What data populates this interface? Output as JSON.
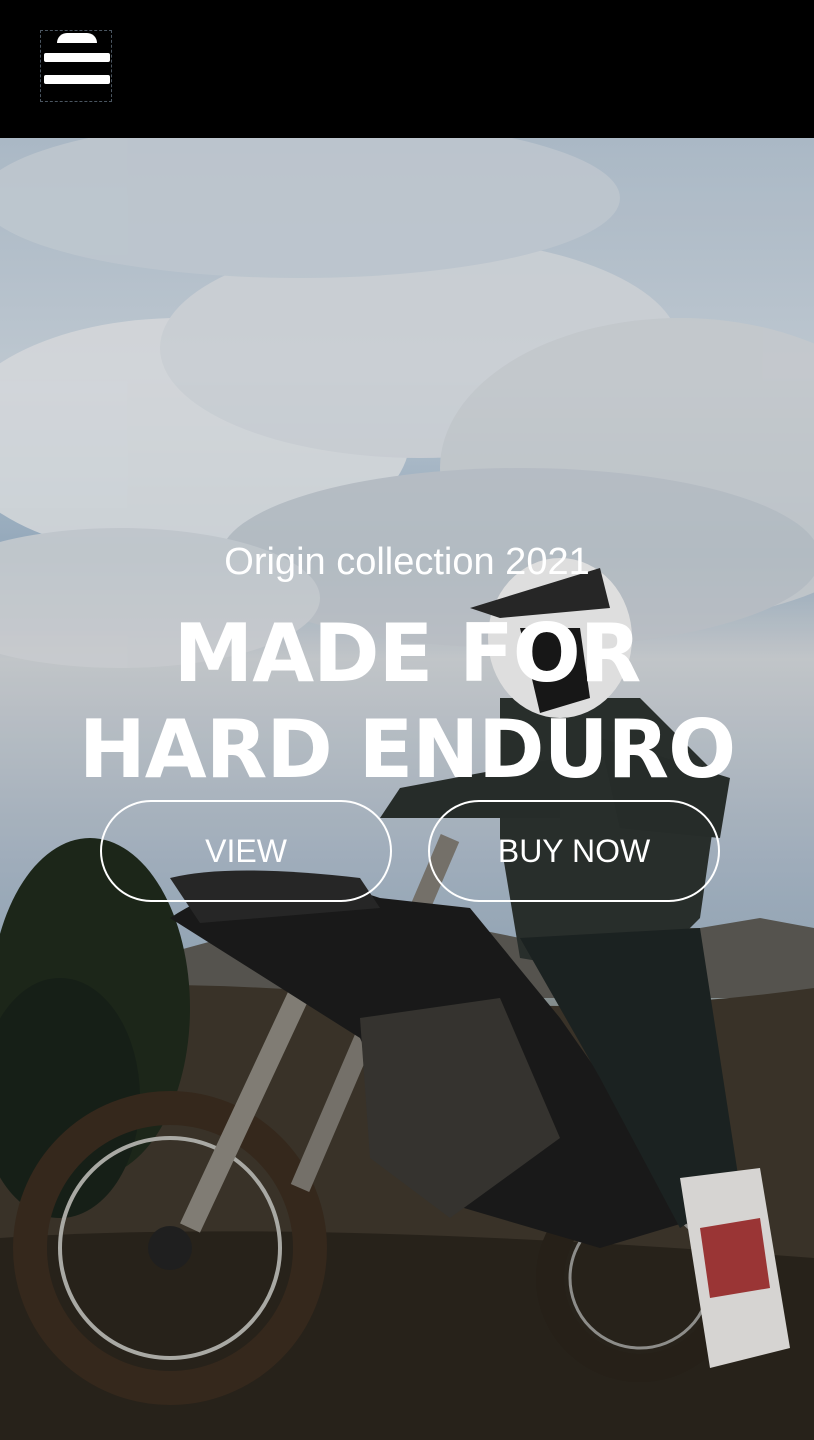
{
  "header": {
    "menu_button_label": "Menu"
  },
  "hero": {
    "subtitle": "Origin collection 2021",
    "headline_line1": "MADE FOR",
    "headline_line2": "HARD ENDURO",
    "buttons": {
      "view": "VIEW",
      "buy": "BUY NOW"
    }
  },
  "colors": {
    "header_background": "#000000",
    "text": "#ffffff",
    "button_border": "#ffffff"
  },
  "icons": {
    "menu": "hamburger-menu-icon"
  }
}
